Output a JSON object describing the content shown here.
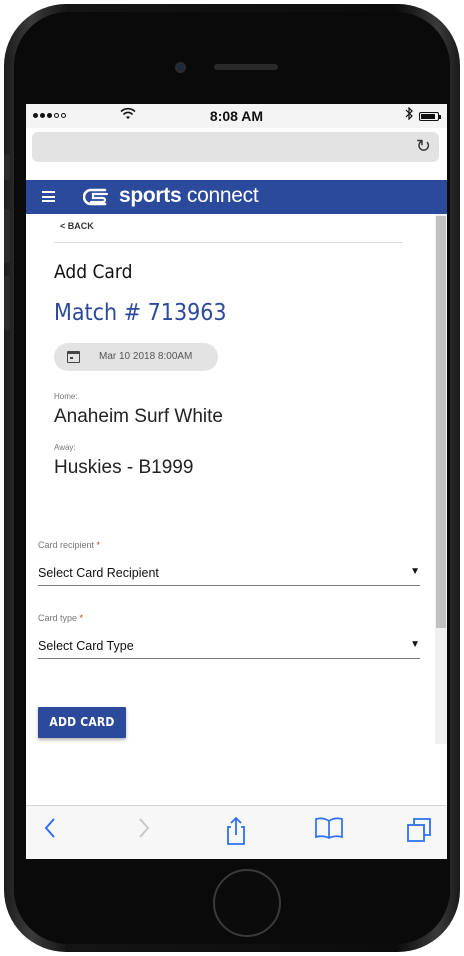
{
  "status_bar": {
    "time": "8:08 AM",
    "signal_icon": "signal-dots-icon",
    "wifi_icon": "wifi-icon",
    "bluetooth_icon": "bluetooth-icon",
    "battery_icon": "battery-icon"
  },
  "browser": {
    "address": "",
    "reload_icon": "reload-icon"
  },
  "app_bar": {
    "brand_bold": "sports",
    "brand_light": " connect",
    "color": "#2c4a9b"
  },
  "page": {
    "back_label": "< BACK",
    "title": "Add Card",
    "match": "Match # 713963",
    "date": "Mar 10 2018 8:00AM",
    "home_label": "Home:",
    "home_team": "Anaheim Surf White",
    "away_label": "Away:",
    "away_team": "Huskies - B1999"
  },
  "form": {
    "recipient_label": "Card recipient",
    "recipient_value": "Select Card Recipient",
    "type_label": "Card type",
    "type_value": "Select Card Type",
    "required_mark": "*",
    "caret": "▼",
    "submit_label": "ADD CARD"
  },
  "toolbar": {
    "back_glyph": "<",
    "forward_glyph": ">",
    "share_glyph": "⍐",
    "bookmarks_glyph": "▢",
    "tabs_glyph": "❐"
  },
  "colors": {
    "accent": "#2c4a9b",
    "ios_blue": "#2f6ff5"
  }
}
